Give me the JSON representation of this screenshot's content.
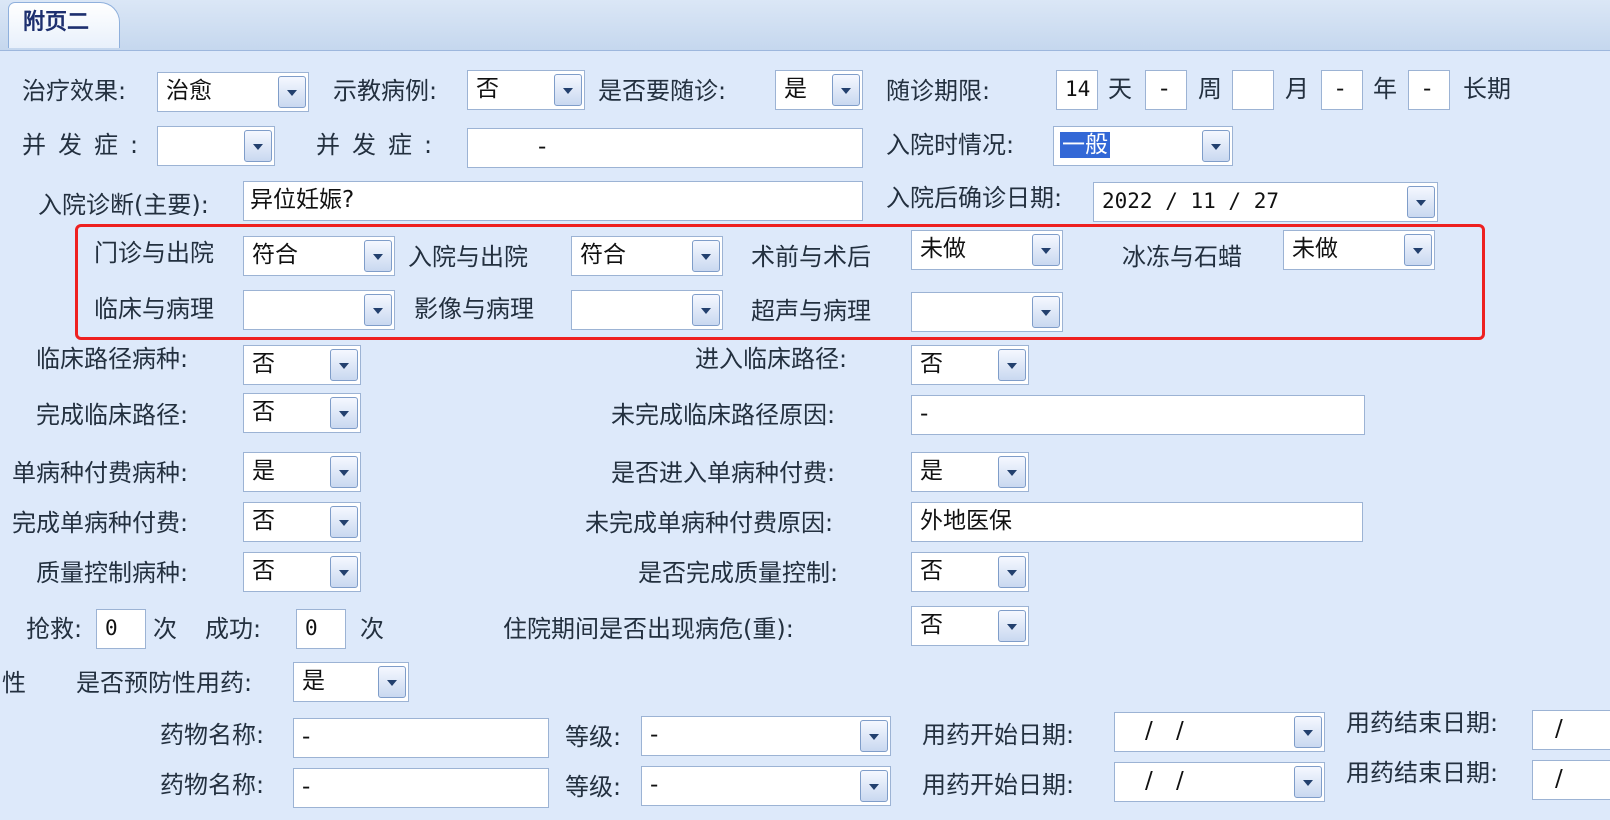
{
  "tab": {
    "label": "附页二"
  },
  "row1": {
    "treatment_effect_label": "治疗效果:",
    "treatment_effect_value": "治愈",
    "teaching_case_label": "示教病例:",
    "teaching_case_value": "否",
    "followup_label": "是否要随诊:",
    "followup_value": "是",
    "followup_period_label": "随诊期限:",
    "days_value": "14",
    "days_unit": "天",
    "weeks_value": "-",
    "weeks_unit": "周",
    "months_value": "",
    "months_unit": "月",
    "years_value": "-",
    "years_unit": "年",
    "long_term_value": "-",
    "long_term_label": "长期"
  },
  "row2": {
    "complication_label": "并发症:",
    "complication_value": "",
    "complication2_label": "并发症:",
    "complication2_value": "-",
    "admission_condition_label": "入院时情况:",
    "admission_condition_value": "一般"
  },
  "row3": {
    "diagnosis_label": "入院诊断(主要):",
    "diagnosis_value": "异位妊娠?",
    "confirm_date_label": "入院后确诊日期:",
    "confirm_date_value": "2022 / 11 / 27"
  },
  "compare": {
    "outpatient_discharge_label": "门诊与出院",
    "outpatient_discharge_value": "符合",
    "admission_discharge_label": "入院与出院",
    "admission_discharge_value": "符合",
    "preop_postop_label": "术前与术后",
    "preop_postop_value": "未做",
    "frozen_paraffin_label": "冰冻与石蜡",
    "frozen_paraffin_value": "未做",
    "clinical_pathology_label": "临床与病理",
    "clinical_pathology_value": "",
    "imaging_pathology_label": "影像与病理",
    "imaging_pathology_value": "",
    "ultrasound_pathology_label": "超声与病理",
    "ultrasound_pathology_value": ""
  },
  "pathway": {
    "disease_label": "临床路径病种:",
    "disease_value": "否",
    "enter_label": "进入临床路径:",
    "enter_value": "否",
    "complete_label": "完成临床路径:",
    "complete_value": "否",
    "incomplete_reason_label": "未完成临床路径原因:",
    "incomplete_reason_value": "-"
  },
  "single_payment": {
    "disease_label": "单病种付费病种:",
    "disease_value": "是",
    "enter_label": "是否进入单病种付费:",
    "enter_value": "是",
    "complete_label": "完成单病种付费:",
    "complete_value": "否",
    "incomplete_reason_label": "未完成单病种付费原因:",
    "incomplete_reason_value": "外地医保"
  },
  "quality": {
    "disease_label": "质量控制病种:",
    "disease_value": "否",
    "complete_label": "是否完成质量控制:",
    "complete_value": "否"
  },
  "rescue": {
    "rescue_label": "抢救:",
    "rescue_value": "0",
    "rescue_unit": "次",
    "success_label": "成功:",
    "success_value": "0",
    "success_unit": "次",
    "critical_label": "住院期间是否出现病危(重):",
    "critical_value": "否"
  },
  "prevention": {
    "left_fragment": "性",
    "label": "是否预防性用药:",
    "value": "是"
  },
  "drugs": [
    {
      "name_label": "药物名称:",
      "name_value": "-",
      "grade_label": "等级:",
      "grade_value": "-",
      "start_label": "用药开始日期:",
      "start_value": "/ /",
      "end_label": "用药结束日期:",
      "end_value": "/"
    },
    {
      "name_label": "药物名称:",
      "name_value": "-",
      "grade_label": "等级:",
      "grade_value": "-",
      "start_label": "用药开始日期:",
      "start_value": "/ /",
      "end_label": "用药结束日期:",
      "end_value": "/"
    }
  ],
  "colors": {
    "highlight_box": "#ee2020",
    "selection": "#3368d6",
    "background": "#dde9fa"
  }
}
